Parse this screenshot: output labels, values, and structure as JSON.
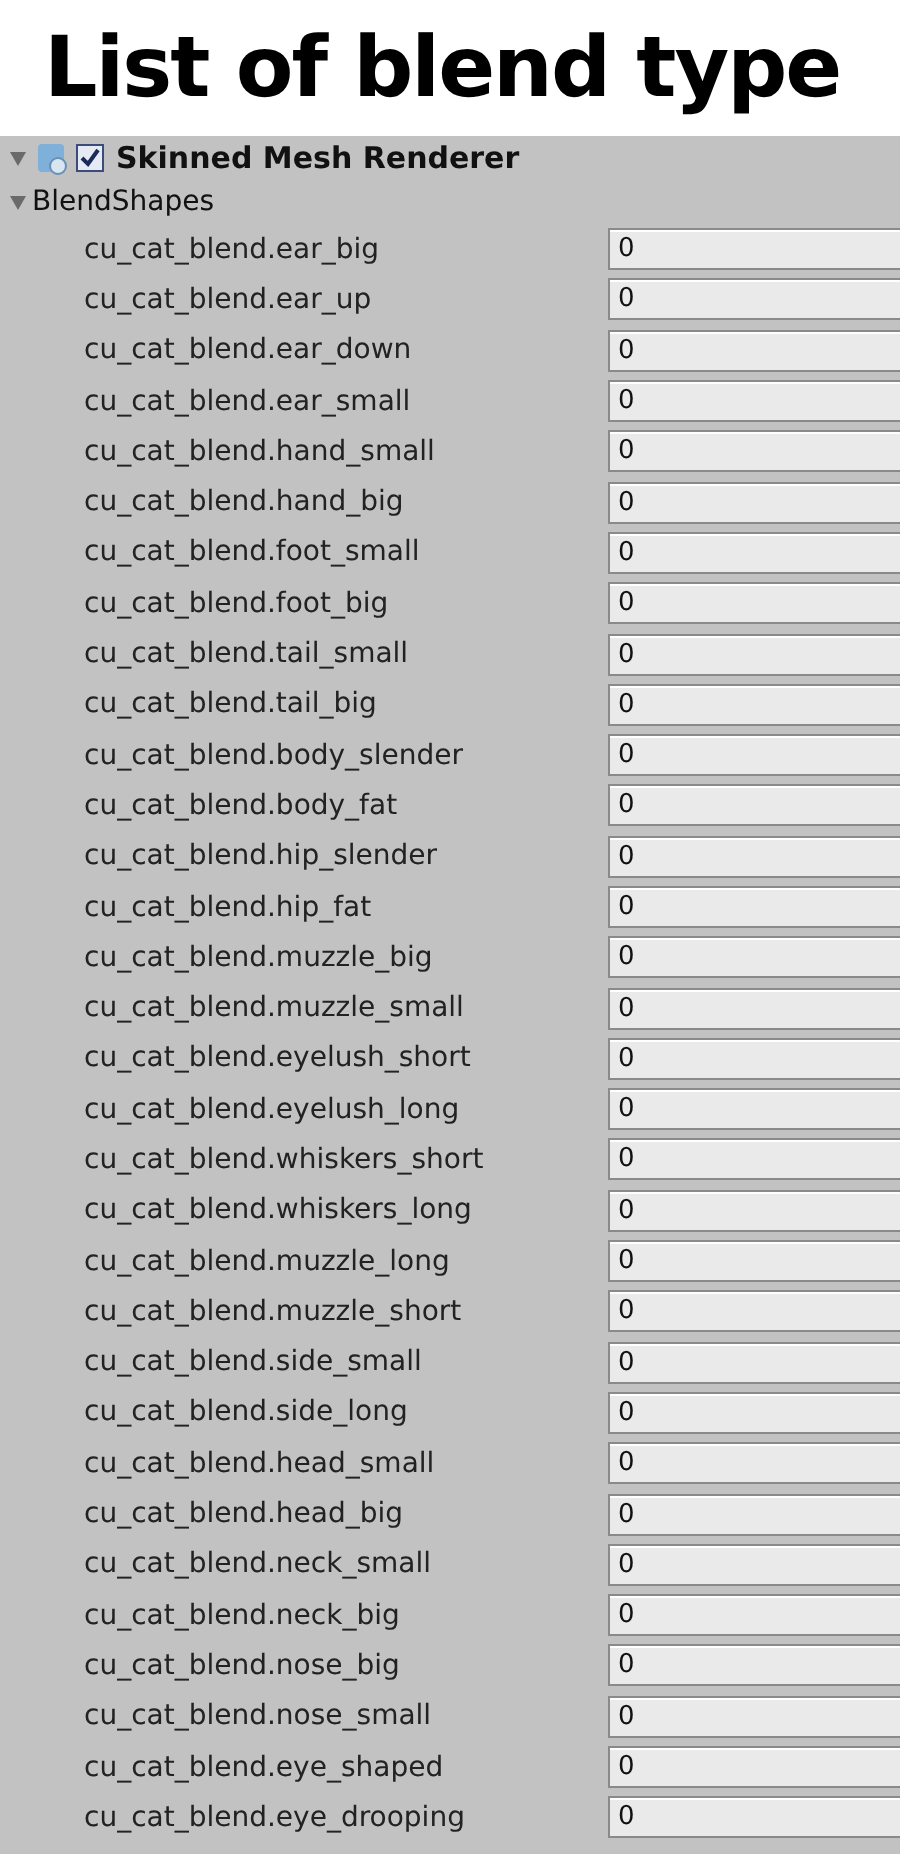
{
  "title": "List of blend type",
  "component": {
    "name": "Skinned Mesh Renderer",
    "expanded": true,
    "enabled": true
  },
  "blend_shapes": {
    "label": "BlendShapes",
    "expanded": true,
    "rows": [
      {
        "name": "cu_cat_blend.ear_big",
        "value": "0"
      },
      {
        "name": "cu_cat_blend.ear_up",
        "value": "0"
      },
      {
        "name": "cu_cat_blend.ear_down",
        "value": "0"
      },
      {
        "name": "cu_cat_blend.ear_small",
        "value": "0"
      },
      {
        "name": "cu_cat_blend.hand_small",
        "value": "0"
      },
      {
        "name": "cu_cat_blend.hand_big",
        "value": "0"
      },
      {
        "name": "cu_cat_blend.foot_small",
        "value": "0"
      },
      {
        "name": "cu_cat_blend.foot_big",
        "value": "0"
      },
      {
        "name": "cu_cat_blend.tail_small",
        "value": "0"
      },
      {
        "name": "cu_cat_blend.tail_big",
        "value": "0"
      },
      {
        "name": "cu_cat_blend.body_slender",
        "value": "0"
      },
      {
        "name": "cu_cat_blend.body_fat",
        "value": "0"
      },
      {
        "name": "cu_cat_blend.hip_slender",
        "value": "0"
      },
      {
        "name": "cu_cat_blend.hip_fat",
        "value": "0"
      },
      {
        "name": "cu_cat_blend.muzzle_big",
        "value": "0"
      },
      {
        "name": "cu_cat_blend.muzzle_small",
        "value": "0"
      },
      {
        "name": "cu_cat_blend.eyelush_short",
        "value": "0"
      },
      {
        "name": "cu_cat_blend.eyelush_long",
        "value": "0"
      },
      {
        "name": "cu_cat_blend.whiskers_short",
        "value": "0"
      },
      {
        "name": "cu_cat_blend.whiskers_long",
        "value": "0"
      },
      {
        "name": "cu_cat_blend.muzzle_long",
        "value": "0"
      },
      {
        "name": "cu_cat_blend.muzzle_short",
        "value": "0"
      },
      {
        "name": "cu_cat_blend.side_small",
        "value": "0"
      },
      {
        "name": "cu_cat_blend.side_long",
        "value": "0"
      },
      {
        "name": "cu_cat_blend.head_small",
        "value": "0"
      },
      {
        "name": "cu_cat_blend.head_big",
        "value": "0"
      },
      {
        "name": "cu_cat_blend.neck_small",
        "value": "0"
      },
      {
        "name": "cu_cat_blend.neck_big",
        "value": "0"
      },
      {
        "name": "cu_cat_blend.nose_big",
        "value": "0"
      },
      {
        "name": "cu_cat_blend.nose_small",
        "value": "0"
      },
      {
        "name": "cu_cat_blend.eye_shaped",
        "value": "0"
      },
      {
        "name": "cu_cat_blend.eye_drooping",
        "value": "0"
      }
    ]
  }
}
